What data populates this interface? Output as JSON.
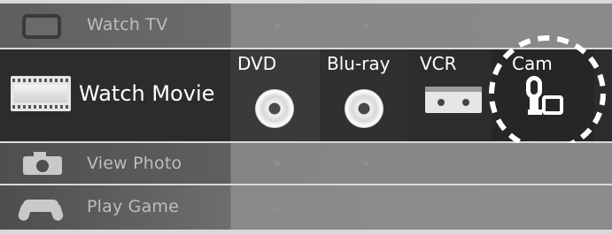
{
  "menu": {
    "rows": [
      {
        "id": "tv",
        "label": "Watch TV",
        "icon": "tv-icon"
      },
      {
        "id": "movie",
        "label": "Watch Movie",
        "icon": "film-icon",
        "selected": true
      },
      {
        "id": "photo",
        "label": "View Photo",
        "icon": "camera-icon"
      },
      {
        "id": "game",
        "label": "Play Game",
        "icon": "gamepad-icon"
      }
    ],
    "movie_sources": [
      {
        "label": "DVD",
        "icon": "disc-icon"
      },
      {
        "label": "Blu-ray",
        "icon": "disc-icon"
      },
      {
        "label": "VCR",
        "icon": "vcr-tape-icon"
      },
      {
        "label": "Cam",
        "icon": "camcorder-icon",
        "highlighted": true
      }
    ]
  },
  "colors": {
    "background": "#7b7b7b",
    "selected_row": "#2c2c2c",
    "inactive_text": "#bdbdbd",
    "active_text": "#ffffff"
  }
}
